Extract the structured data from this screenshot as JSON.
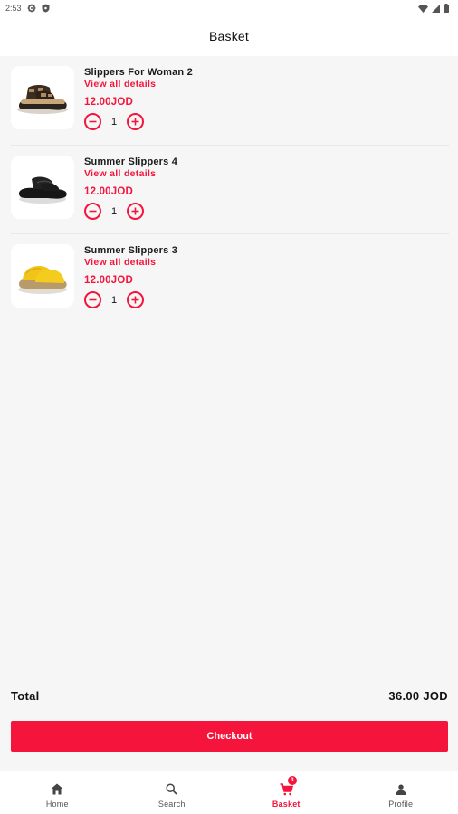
{
  "status_bar": {
    "time": "2:53"
  },
  "header": {
    "title": "Basket"
  },
  "basket": {
    "items": [
      {
        "name": "Slippers For Woman 2",
        "details_link": "View all details",
        "price": "12.00JOD",
        "quantity": "1",
        "image": "brown-sandal"
      },
      {
        "name": "Summer Slippers 4",
        "details_link": "View all details",
        "price": "12.00JOD",
        "quantity": "1",
        "image": "black-toe-post-sandal"
      },
      {
        "name": "Summer Slippers 3",
        "details_link": "View all details",
        "price": "12.00JOD",
        "quantity": "1",
        "image": "yellow-clog"
      }
    ]
  },
  "summary": {
    "total_label": "Total",
    "total_value": "36.00 JOD",
    "checkout_label": "Checkout"
  },
  "bottom_nav": {
    "items": [
      {
        "label": "Home",
        "icon": "home-icon"
      },
      {
        "label": "Search",
        "icon": "search-icon"
      },
      {
        "label": "Basket",
        "icon": "cart-icon",
        "badge": "3",
        "active": true
      },
      {
        "label": "Profile",
        "icon": "person-icon"
      }
    ]
  },
  "colors": {
    "accent": "#f5143c",
    "background": "#f6f6f6",
    "surface": "#ffffff"
  }
}
